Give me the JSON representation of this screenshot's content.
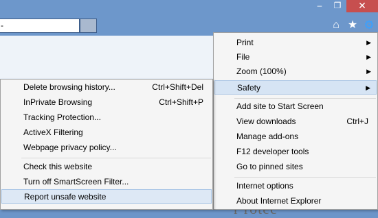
{
  "window": {
    "minimize_icon": "minimize-icon",
    "maximize_icon": "restore-icon",
    "close_icon": "close-icon"
  },
  "address_bar": {
    "value": "-"
  },
  "toolbar": {
    "icons": [
      "home-icon",
      "favorites-star-icon",
      "tools-gear-icon"
    ]
  },
  "page": {
    "fragment_text": "r rotec"
  },
  "main_menu": {
    "items": [
      {
        "label": "Print",
        "has_submenu": true
      },
      {
        "label": "File",
        "has_submenu": true
      },
      {
        "label": "Zoom (100%)",
        "has_submenu": true
      },
      {
        "label": "Safety",
        "has_submenu": true,
        "highlighted": true
      },
      {
        "label": "Add site to Start Screen"
      },
      {
        "label": "View downloads",
        "shortcut": "Ctrl+J"
      },
      {
        "label": "Manage add-ons"
      },
      {
        "label": "F12 developer tools"
      },
      {
        "label": "Go to pinned sites"
      },
      {
        "label": "Internet options"
      },
      {
        "label": "About Internet Explorer"
      }
    ]
  },
  "safety_submenu": {
    "items": [
      {
        "label": "Delete browsing history...",
        "shortcut": "Ctrl+Shift+Del"
      },
      {
        "label": "InPrivate Browsing",
        "shortcut": "Ctrl+Shift+P"
      },
      {
        "label": "Tracking Protection..."
      },
      {
        "label": "ActiveX Filtering"
      },
      {
        "label": "Webpage privacy policy..."
      },
      {
        "label": "Check this website"
      },
      {
        "label": "Turn off SmartScreen Filter..."
      },
      {
        "label": "Report unsafe website",
        "highlighted": true
      }
    ]
  },
  "colors": {
    "titlebar": "#6d97cb",
    "close_button": "#c74f4f",
    "menu_bg": "#f5f5f5",
    "highlight": "#dde8f5"
  }
}
